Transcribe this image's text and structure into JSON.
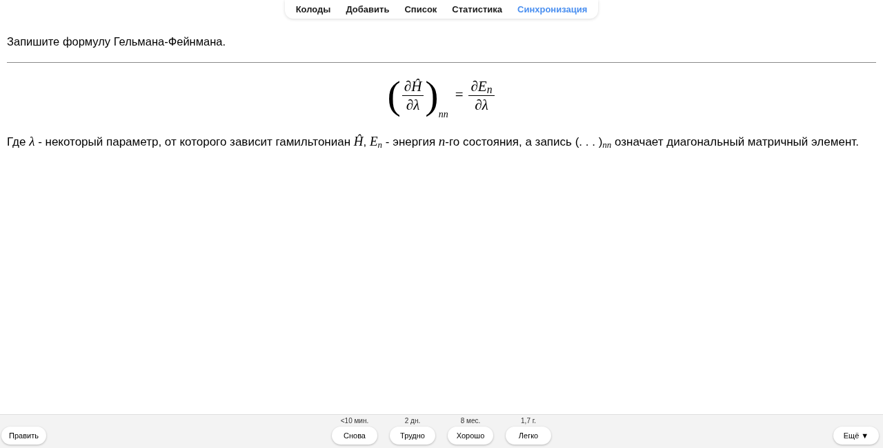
{
  "nav": [
    {
      "label": "Колоды",
      "color": "#1a1a1a"
    },
    {
      "label": "Добавить",
      "color": "#1a1a1a"
    },
    {
      "label": "Список",
      "color": "#1a1a1a"
    },
    {
      "label": "Статистика",
      "color": "#1a1a1a"
    },
    {
      "label": "Синхронизация",
      "color": "#4a8ff0"
    }
  ],
  "card": {
    "question": "Запишите формулу Гельмана-Фейнмана.",
    "formula": {
      "open_bracket": "(",
      "lhs": {
        "numerator": "∂Ĥ",
        "denominator": "∂λ"
      },
      "close_bracket": ")",
      "lhs_subscript": "nn",
      "relation": "=",
      "rhs": {
        "numerator": "∂E$_{n}$",
        "denominator": "∂λ"
      }
    },
    "explanation": "Где *λ* - некоторый параметр, от которого зависит гамильтониан *Ĥ*, *E*$_{n}$ - энергия *n*-го состояния, а запись (. . . )$_{nn}$ означает диагональный матричный элемент."
  },
  "bottom_bar": {
    "edit_button": "Править",
    "answer_buttons": [
      {
        "interval": "<10 мин.",
        "label": "Снова"
      },
      {
        "interval": "2 дн.",
        "label": "Трудно"
      },
      {
        "interval": "8 мес.",
        "label": "Хорошо"
      },
      {
        "interval": "1,7 г.",
        "label": "Легко"
      }
    ],
    "more_button": "Ещё ▼"
  }
}
